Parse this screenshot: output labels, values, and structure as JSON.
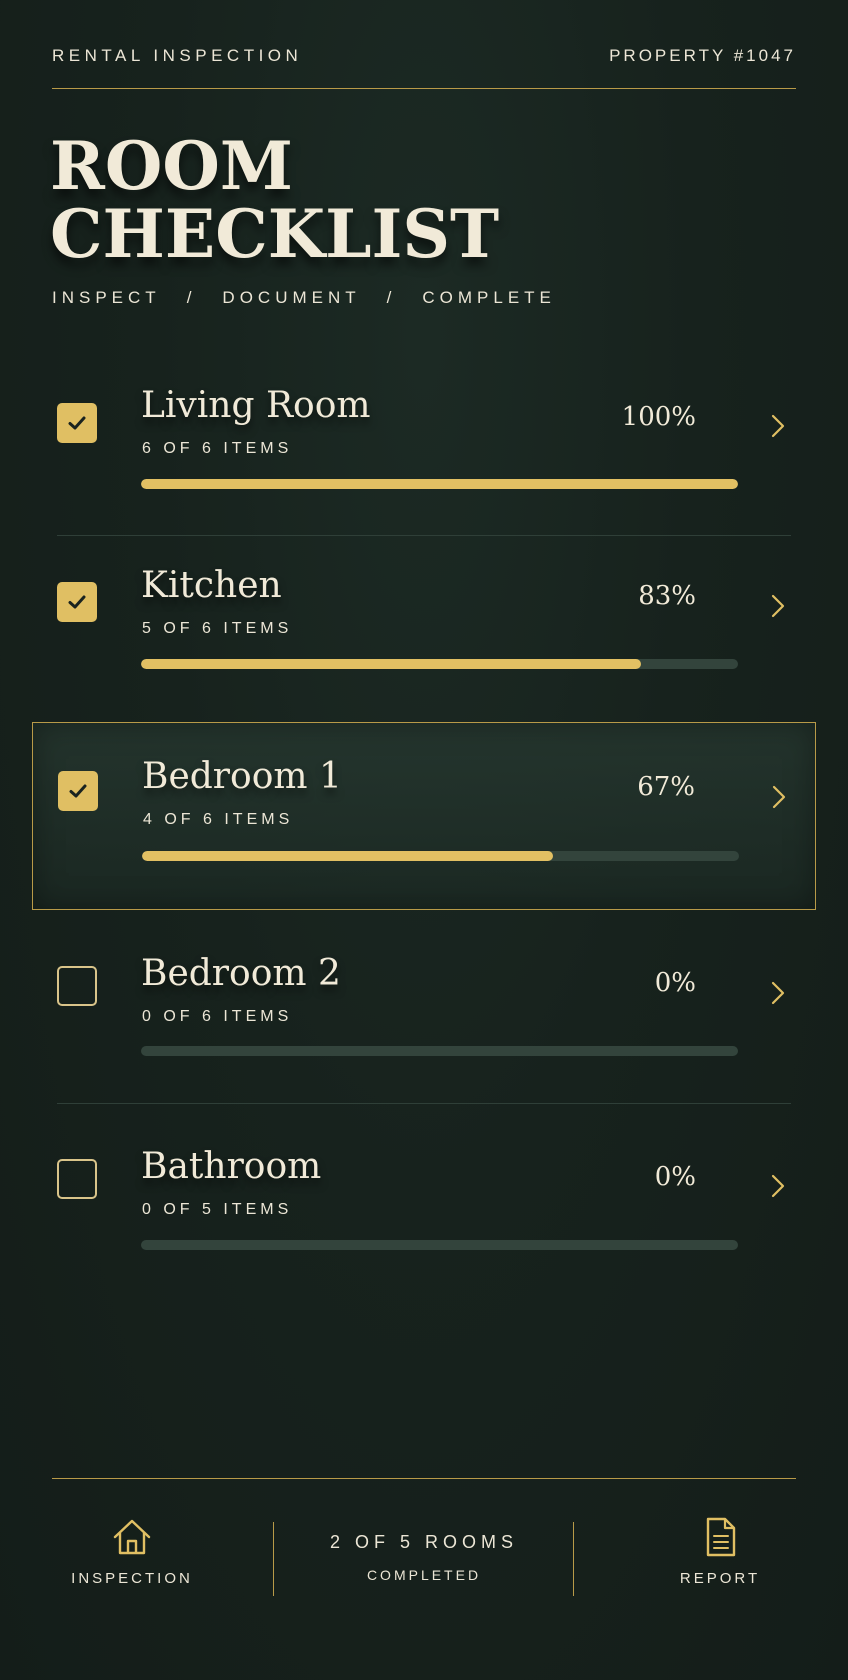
{
  "header": {
    "left_label": "RENTAL INSPECTION",
    "right_label": "PROPERTY #1047"
  },
  "title": {
    "line1": "ROOM",
    "line2": "CHECKLIST"
  },
  "subtitle": {
    "step1": "INSPECT",
    "sep1": "/",
    "step2": "DOCUMENT",
    "sep2": "/",
    "step3": "COMPLETE"
  },
  "rooms": [
    {
      "name": "Living Room",
      "count": "6 OF 6 ITEMS",
      "percent": "100%",
      "progress": 1.0,
      "checked": true,
      "active": false
    },
    {
      "name": "Kitchen",
      "count": "5 OF 6 ITEMS",
      "percent": "83%",
      "progress": 0.837,
      "checked": true,
      "active": false
    },
    {
      "name": "Bedroom 1",
      "count": "4 OF 6 ITEMS",
      "percent": "67%",
      "progress": 0.688,
      "checked": true,
      "active": true
    },
    {
      "name": "Bedroom 2",
      "count": "0 OF 6 ITEMS",
      "percent": "0%",
      "progress": 0,
      "checked": false,
      "active": false
    },
    {
      "name": "Bathroom",
      "count": "0 OF 5 ITEMS",
      "percent": "0%",
      "progress": 0,
      "checked": false,
      "active": false
    }
  ],
  "footer": {
    "inspection_label": "INSPECTION",
    "status_line1": "2 OF 5 ROOMS",
    "status_line2": "COMPLETED",
    "report_label": "REPORT"
  },
  "colors": {
    "accent": "#e2c063",
    "background": "#17221d",
    "text": "#ece6d6",
    "track": "#33443c"
  },
  "icons": {
    "check": "check-icon",
    "chevron": "chevron-right-icon",
    "home": "home-icon",
    "report": "document-icon"
  }
}
